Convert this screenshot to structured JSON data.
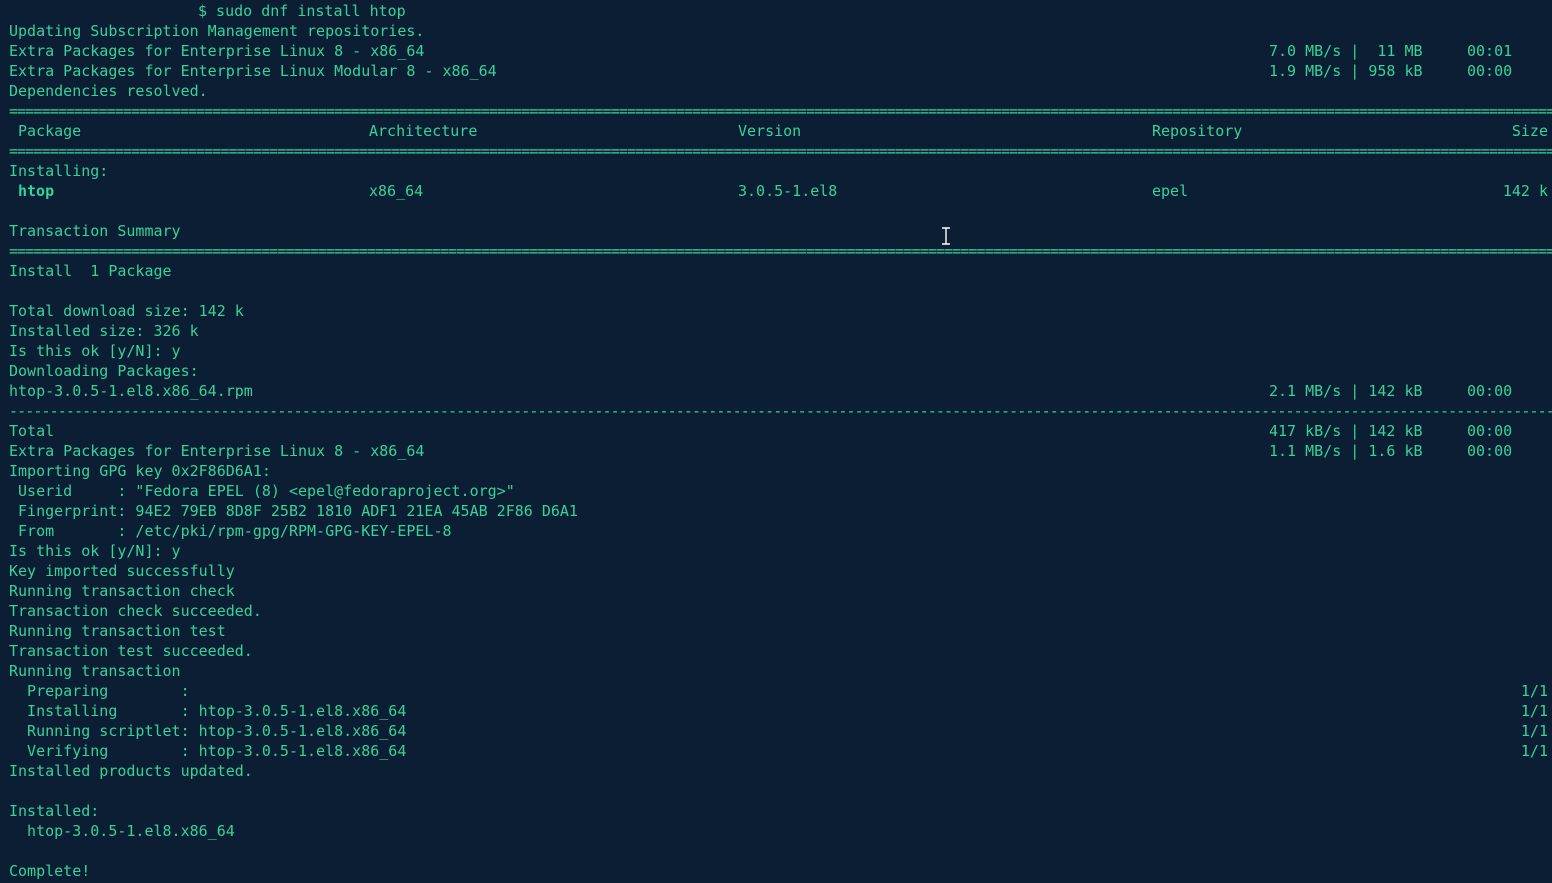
{
  "terminal": {
    "command_line": "$ sudo dnf install htop",
    "updating": "Updating Subscription Management repositories.",
    "repos": [
      {
        "name": "Extra Packages for Enterprise Linux 8 - x86_64",
        "speed": "7.0 MB/s |  11 MB",
        "time": "00:01"
      },
      {
        "name": "Extra Packages for Enterprise Linux Modular 8 - x86_64",
        "speed": "1.9 MB/s | 958 kB",
        "time": "00:00"
      }
    ],
    "deps_resolved": "Dependencies resolved.",
    "rule_eq": "==================================================================================================================================================================================================",
    "rule_dash": "--------------------------------------------------------------------------------------------------------------------------------------------------------------------------------------------------",
    "table": {
      "headers": {
        "package": "Package",
        "arch": "Architecture",
        "version": "Version",
        "repo": "Repository",
        "size": "Size"
      },
      "installing_label": "Installing:",
      "row": {
        "package": "htop",
        "arch": "x86_64",
        "version": "3.0.5-1.el8",
        "repo": "epel",
        "size": "142 k"
      }
    },
    "transaction_summary": "Transaction Summary",
    "install_count": "Install  1 Package",
    "total_download": "Total download size: 142 k",
    "installed_size": "Installed size: 326 k",
    "confirm1": "Is this ok [y/N]: y",
    "downloading": "Downloading Packages:",
    "download_file": {
      "name": "htop-3.0.5-1.el8.x86_64.rpm",
      "speed": "2.1 MB/s | 142 kB",
      "time": "00:00"
    },
    "total": {
      "name": "Total",
      "speed": "417 kB/s | 142 kB",
      "time": "00:00"
    },
    "epel_key_repo": {
      "name": "Extra Packages for Enterprise Linux 8 - x86_64",
      "speed": "1.1 MB/s | 1.6 kB",
      "time": "00:00"
    },
    "importing_key": "Importing GPG key 0x2F86D6A1:",
    "userid": " Userid     : \"Fedora EPEL (8) <epel@fedoraproject.org>\"",
    "fingerprint": " Fingerprint: 94E2 79EB 8D8F 25B2 1810 ADF1 21EA 45AB 2F86 D6A1",
    "from": " From       : /etc/pki/rpm-gpg/RPM-GPG-KEY-EPEL-8",
    "confirm2": "Is this ok [y/N]: y",
    "key_imported": "Key imported successfully",
    "running_check": "Running transaction check",
    "check_ok": "Transaction check succeeded.",
    "running_test": "Running transaction test",
    "test_ok": "Transaction test succeeded.",
    "running_tx": "Running transaction",
    "steps": [
      {
        "text": "  Preparing        :",
        "count": "1/1"
      },
      {
        "text": "  Installing       : htop-3.0.5-1.el8.x86_64",
        "count": "1/1"
      },
      {
        "text": "  Running scriptlet: htop-3.0.5-1.el8.x86_64",
        "count": "1/1"
      },
      {
        "text": "  Verifying        : htop-3.0.5-1.el8.x86_64",
        "count": "1/1"
      }
    ],
    "products_updated": "Installed products updated.",
    "installed_label": "Installed:",
    "installed_pkg": "  htop-3.0.5-1.el8.x86_64",
    "complete": "Complete!"
  },
  "colors": {
    "background": "#0b1e33",
    "text": "#34d49a"
  },
  "cursor": "ibeam-cursor-icon"
}
